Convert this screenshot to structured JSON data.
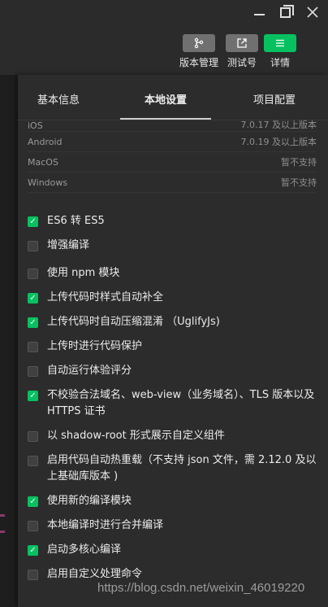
{
  "window": {
    "minimize": "—",
    "maximize": "□",
    "close": "✕"
  },
  "toolbar": {
    "version_control": "版本管理",
    "test_account": "测试号",
    "details": "详情"
  },
  "tabs": {
    "basic": "基本信息",
    "local": "本地设置",
    "project": "项目配置"
  },
  "system": [
    {
      "os": "iOS",
      "version": "7.0.17 及以上版本"
    },
    {
      "os": "Android",
      "version": "7.0.19 及以上版本"
    },
    {
      "os": "MacOS",
      "version": "暂不支持"
    },
    {
      "os": "Windows",
      "version": "暂不支持"
    }
  ],
  "options": [
    {
      "label": "ES6 转 ES5",
      "checked": true
    },
    {
      "label": "增强编译",
      "checked": false
    },
    {
      "label": "使用 npm 模块",
      "checked": false
    },
    {
      "label": "上传代码时样式自动补全",
      "checked": true
    },
    {
      "label": "上传代码时自动压缩混淆 （UglifyJs)",
      "checked": true
    },
    {
      "label": "上传时进行代码保护",
      "checked": false
    },
    {
      "label": "自动运行体验评分",
      "checked": false
    },
    {
      "label": "不校验合法域名、web-view（业务域名）、TLS 版本以及 HTTPS 证书",
      "checked": true
    },
    {
      "label": "以 shadow-root 形式展示自定义组件",
      "checked": false
    },
    {
      "label": "启用代码自动热重载（不支持 json 文件，需 2.12.0 及以上基础库版本 )",
      "checked": false
    },
    {
      "label": "使用新的编译模块",
      "checked": true
    },
    {
      "label": "本地编译时进行合并编译",
      "checked": false
    },
    {
      "label": "启动多核心编译",
      "checked": true
    },
    {
      "label": "启用自定义处理命令",
      "checked": false
    }
  ],
  "watermark": "https://blog.csdn.net/weixin_46019220",
  "colors": {
    "accent": "#07c160",
    "panel": "#2c2c2c",
    "gray_button": "#707070"
  },
  "icons": [
    "branch-icon",
    "external-link-icon",
    "menu-icon"
  ]
}
